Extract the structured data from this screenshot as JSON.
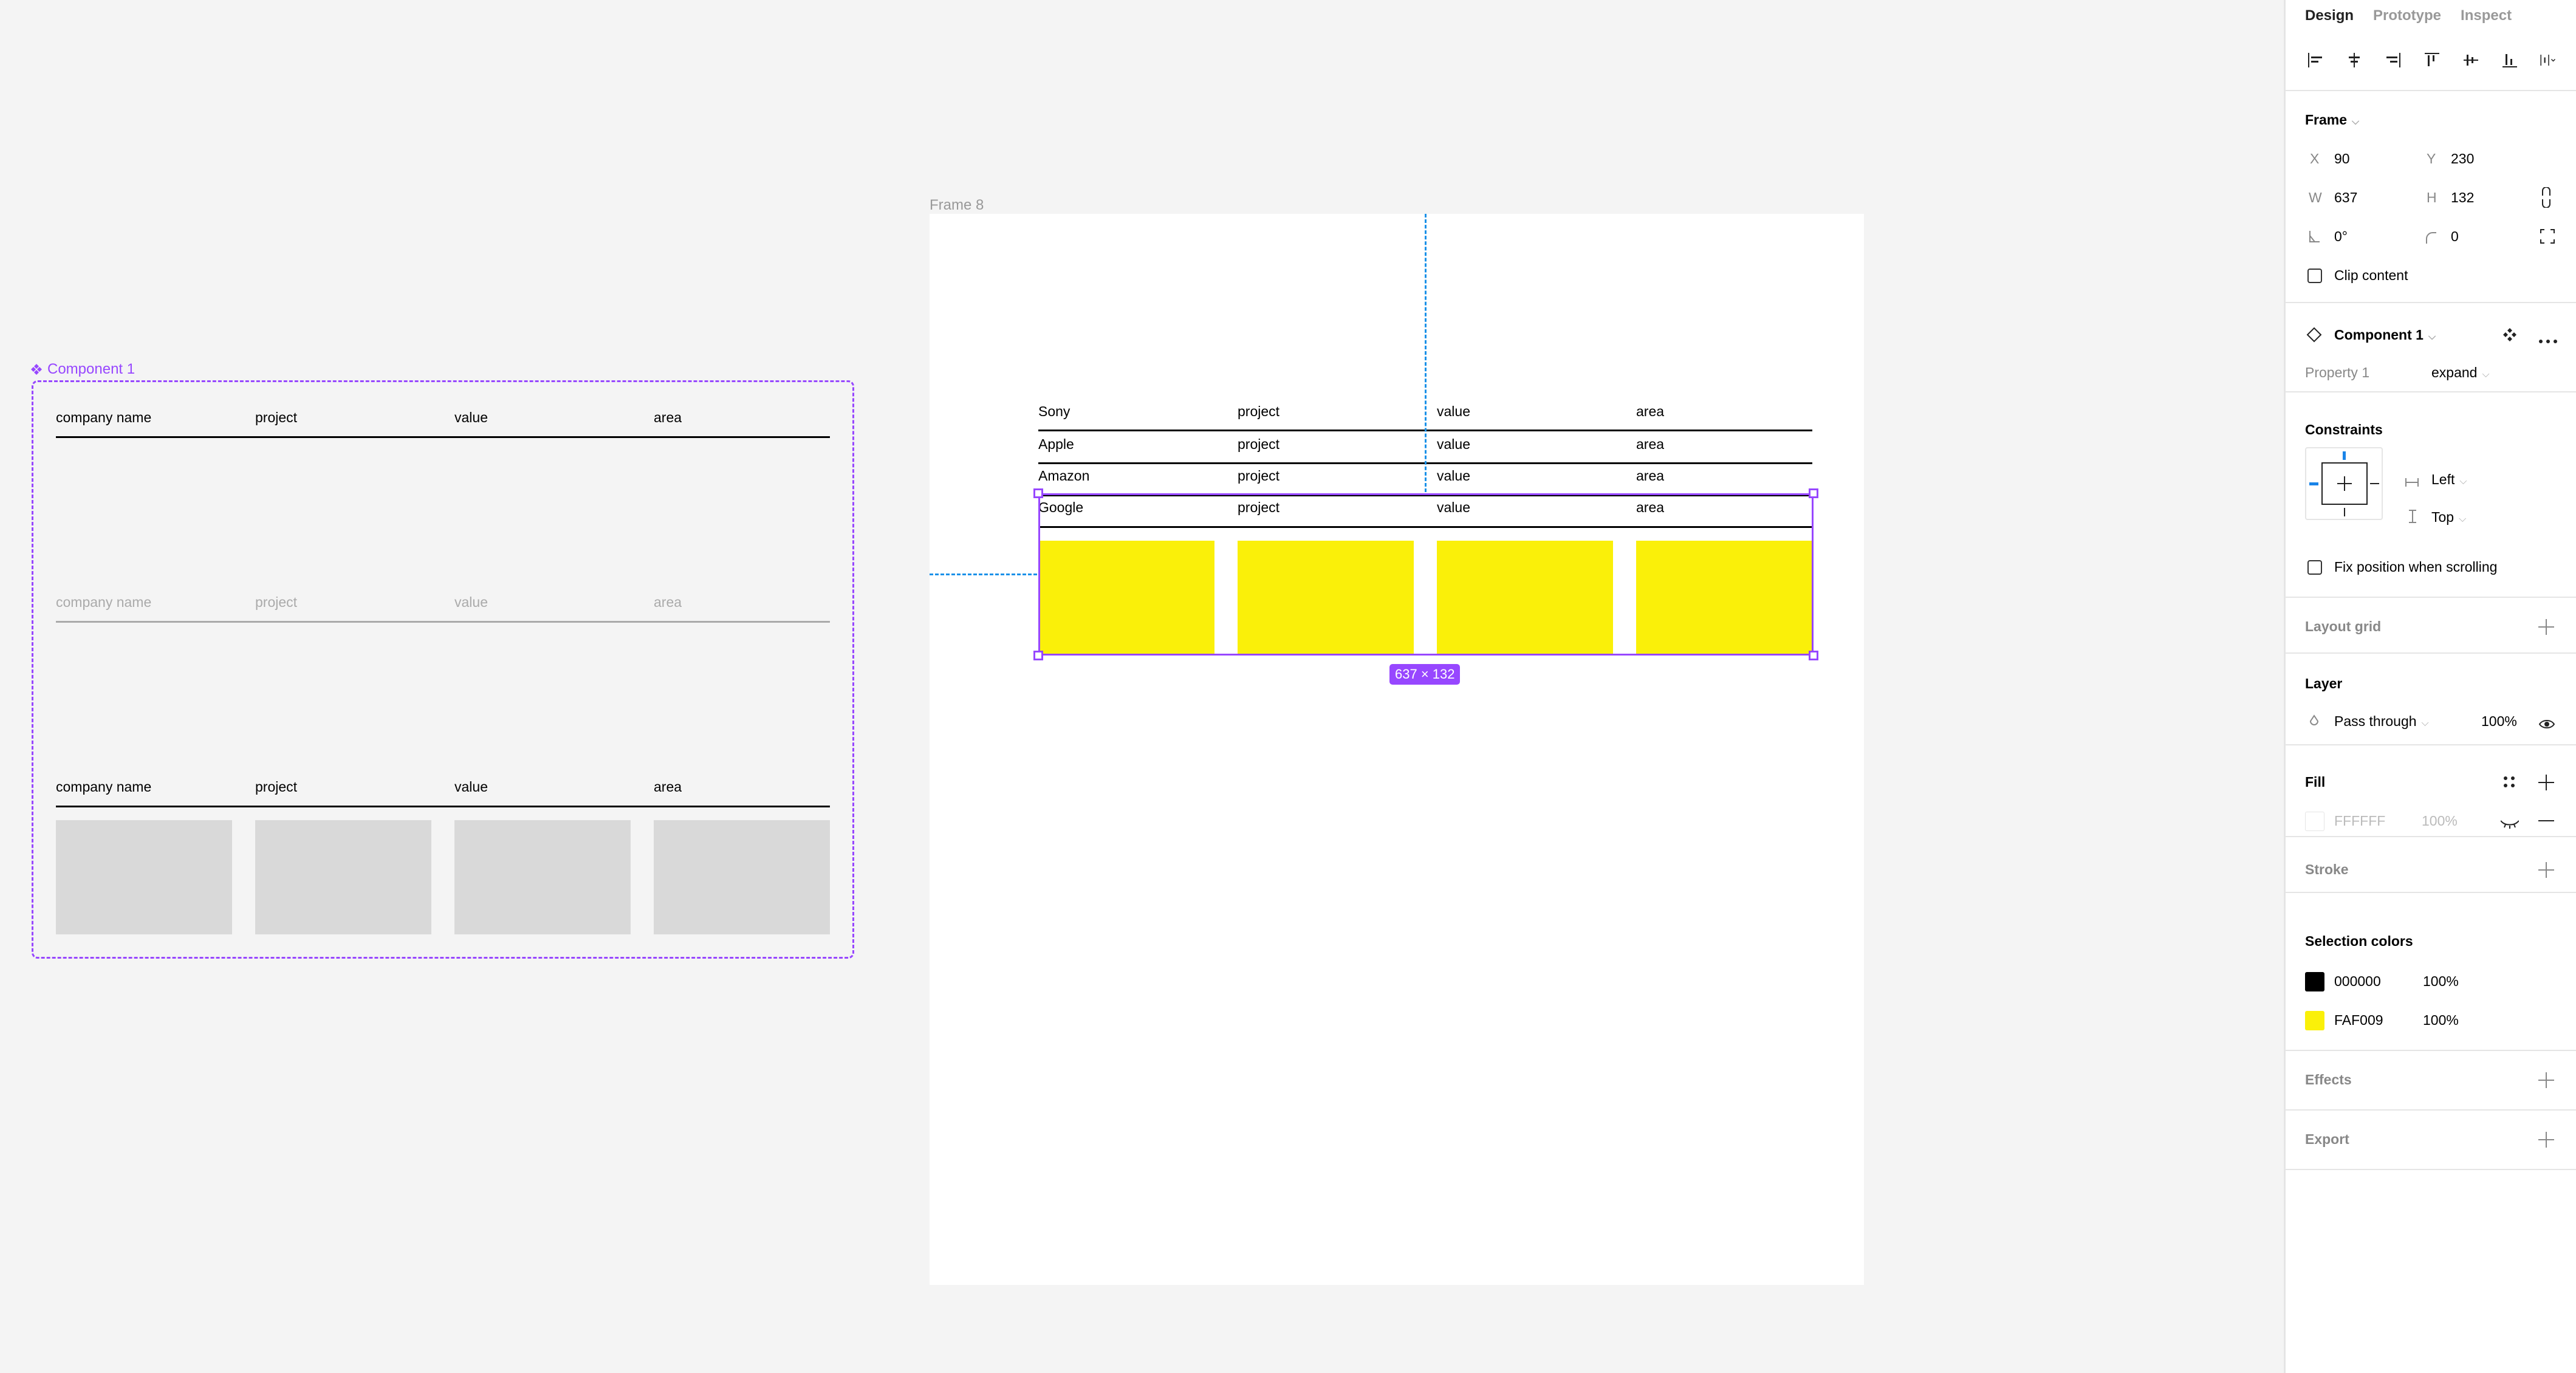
{
  "canvas": {
    "component": {
      "label": "Component 1",
      "variant_collapsed": {
        "headers": [
          "company name",
          "project",
          "value",
          "area"
        ]
      },
      "variant_ghost": {
        "headers": [
          "company name",
          "project",
          "value",
          "area"
        ]
      },
      "variant_expand": {
        "headers": [
          "company name",
          "project",
          "value",
          "area"
        ]
      }
    },
    "frame": {
      "label": "Frame 8",
      "rows": [
        {
          "company": "Sony",
          "project": "project",
          "value": "value",
          "area": "area"
        },
        {
          "company": "Apple",
          "project": "project",
          "value": "value",
          "area": "area"
        },
        {
          "company": "Amazon",
          "project": "project",
          "value": "value",
          "area": "area"
        },
        {
          "company": "Google",
          "project": "project",
          "value": "value",
          "area": "area"
        }
      ],
      "selection_size": "637 × 132"
    },
    "colors": {
      "selection": "#9747ff",
      "guide": "#1a91e8",
      "highlight": "#faf009",
      "placeholder": "#d9d9d9"
    }
  },
  "panel": {
    "tabs": [
      "Design",
      "Prototype",
      "Inspect"
    ],
    "active_tab": "Design",
    "frame": {
      "title": "Frame",
      "x_label": "X",
      "x": "90",
      "y_label": "Y",
      "y": "230",
      "w_label": "W",
      "w": "637",
      "h_label": "H",
      "h": "132",
      "rotation": "0°",
      "radius": "0",
      "clip_content": "Clip content"
    },
    "component": {
      "name": "Component 1",
      "property_label": "Property 1",
      "property_value": "expand"
    },
    "constraints": {
      "title": "Constraints",
      "horizontal": "Left",
      "vertical": "Top",
      "fix_position": "Fix position when scrolling"
    },
    "layout_grid": {
      "title": "Layout grid"
    },
    "layer": {
      "title": "Layer",
      "blend": "Pass through",
      "opacity": "100%"
    },
    "fill": {
      "title": "Fill",
      "hex": "FFFFFF",
      "opacity": "100%"
    },
    "stroke": {
      "title": "Stroke"
    },
    "selection_colors": {
      "title": "Selection colors",
      "items": [
        {
          "hex": "000000",
          "opacity": "100%",
          "color": "#000000"
        },
        {
          "hex": "FAF009",
          "opacity": "100%",
          "color": "#faf009"
        }
      ]
    },
    "effects": {
      "title": "Effects"
    },
    "export": {
      "title": "Export"
    }
  }
}
